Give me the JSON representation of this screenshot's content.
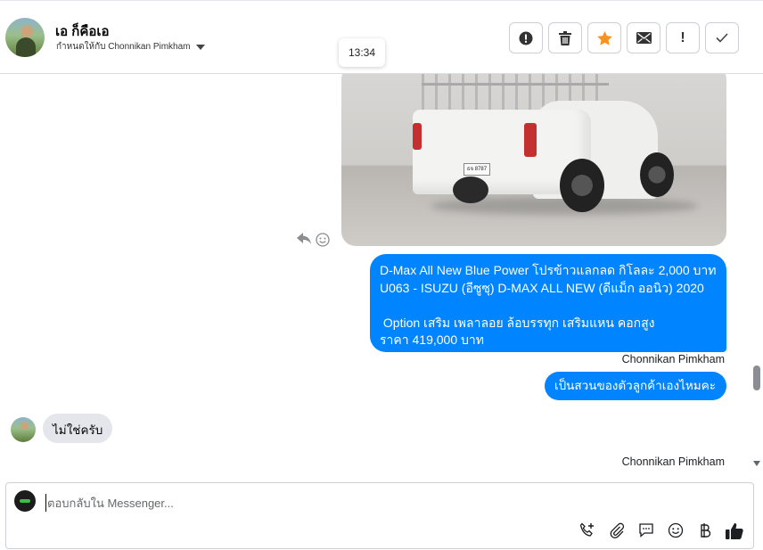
{
  "header": {
    "contact_name": "เอ ก็คือเอ",
    "assign_text": "กำหนดให้กับ Chonnikan Pimkham",
    "toolbar": {
      "buttons": [
        "spam-alert",
        "delete",
        "star",
        "mark-unread",
        "follow-up",
        "done"
      ],
      "follow_up_label": "!",
      "star_color": "#f7931e"
    }
  },
  "tooltip": {
    "time": "13:34"
  },
  "messages": {
    "photo": {
      "plate_text": "ธจ 8787"
    },
    "main_bubble": "D-Max All New Blue Power โปรข้าวแลกลด กิโลละ 2,000 บาท\nU063 - ISUZU (อีซูซุ) D-MAX ALL NEW (ดีแม็ก ออนิว) 2020\n\n Option เสริม เพลาลอย ล้อบรรทุก เสริมแหน คอกสูง\nราคา 419,000 บาท",
    "sender_1": "Chonnikan Pimkham",
    "short_bubble": "เป็นสวนของตัวลูกค้าเองไหมคะ",
    "incoming_bubble": "ไม่ใช่ครับ",
    "sender_2": "Chonnikan Pimkham"
  },
  "composer": {
    "placeholder": "ตอบกลับใน Messenger..."
  },
  "colors": {
    "outgoing_bubble": "#0084ff",
    "incoming_bubble": "#e4e6eb"
  }
}
